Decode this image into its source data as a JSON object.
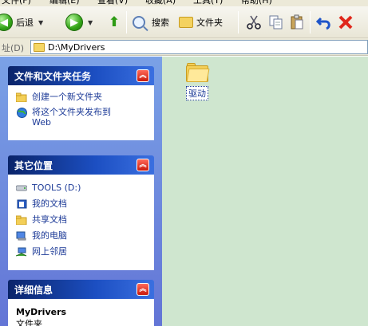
{
  "menubar": {
    "items": [
      "文件(F)",
      "编辑(E)",
      "查看(V)",
      "收藏(A)",
      "工具(T)",
      "帮助(H)"
    ]
  },
  "toolbar": {
    "back_label": "后退",
    "search_label": "搜索",
    "folders_label": "文件夹"
  },
  "address": {
    "label": "址(D)",
    "path": "D:\\MyDrivers"
  },
  "panels": {
    "file_tasks": {
      "title": "文件和文件夹任务",
      "items": [
        {
          "label": "创建一个新文件夹"
        },
        {
          "label": "将这个文件夹发布到\nWeb"
        }
      ]
    },
    "other_places": {
      "title": "其它位置",
      "items": [
        {
          "label": "TOOLS (D:)"
        },
        {
          "label": "我的文档"
        },
        {
          "label": "共享文档"
        },
        {
          "label": "我的电脑"
        },
        {
          "label": "网上邻居"
        }
      ]
    },
    "details": {
      "title": "详细信息",
      "name": "MyDrivers",
      "type": "文件夹"
    }
  },
  "content": {
    "items": [
      {
        "label": "驱动"
      }
    ]
  }
}
